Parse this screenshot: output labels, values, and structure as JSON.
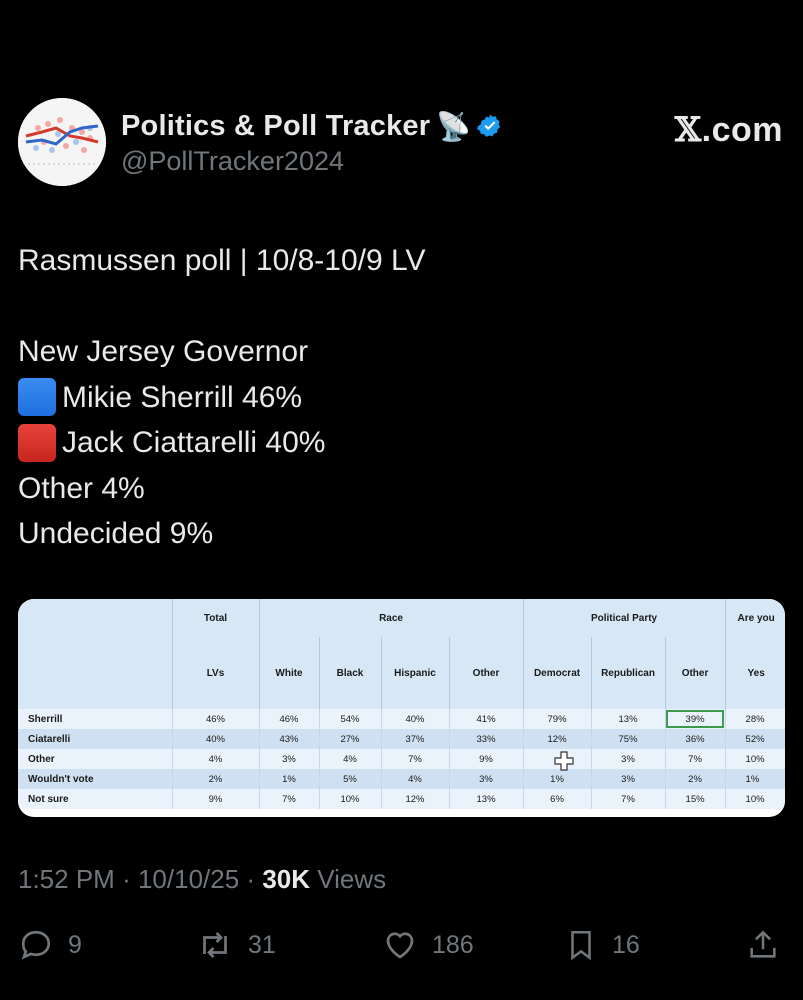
{
  "author": {
    "display_name": "Politics & Poll Tracker",
    "handle": "@PollTracker2024",
    "emoji": "📡",
    "verified": true,
    "verified_color": "#1d9bf0"
  },
  "brand": {
    "x": "𝕏",
    "suffix": ".com"
  },
  "tweet": {
    "lines": [
      "Rasmussen poll | 10/8-10/9 LV",
      "",
      "New Jersey Governor",
      "Mikie Sherrill 46%",
      "Jack Ciattarelli 40%",
      "Other 4%",
      "Undecided 9%"
    ]
  },
  "poll_table": {
    "groups": [
      "Total",
      "Race",
      "Political Party",
      "Are you"
    ],
    "columns": [
      "LVs",
      "White",
      "Black",
      "Hispanic",
      "Other",
      "Democrat",
      "Republican",
      "Other",
      "Yes"
    ],
    "rows": [
      {
        "label": "Sherrill",
        "values": [
          "46%",
          "46%",
          "54%",
          "40%",
          "41%",
          "79%",
          "13%",
          "39%",
          "28%"
        ]
      },
      {
        "label": "Ciatarelli",
        "values": [
          "40%",
          "43%",
          "27%",
          "37%",
          "33%",
          "12%",
          "75%",
          "36%",
          "52%"
        ]
      },
      {
        "label": "Other",
        "values": [
          "4%",
          "3%",
          "4%",
          "7%",
          "9%",
          "",
          "3%",
          "7%",
          "10%"
        ]
      },
      {
        "label": "Wouldn't vote",
        "values": [
          "2%",
          "1%",
          "5%",
          "4%",
          "3%",
          "1%",
          "3%",
          "2%",
          "1%"
        ]
      },
      {
        "label": "Not sure",
        "values": [
          "9%",
          "7%",
          "10%",
          "12%",
          "13%",
          "6%",
          "7%",
          "15%",
          "10%"
        ]
      }
    ]
  },
  "meta": {
    "time": "1:52 PM",
    "sep": "·",
    "date": "10/10/25",
    "views_count": "30K",
    "views_label": "Views"
  },
  "actions": {
    "replies": "9",
    "reposts": "31",
    "likes": "186",
    "bookmarks": "16"
  },
  "colors": {
    "background": "#000000",
    "text": "#e7e9ea",
    "muted": "#71767b",
    "accent": "#1d9bf0"
  }
}
